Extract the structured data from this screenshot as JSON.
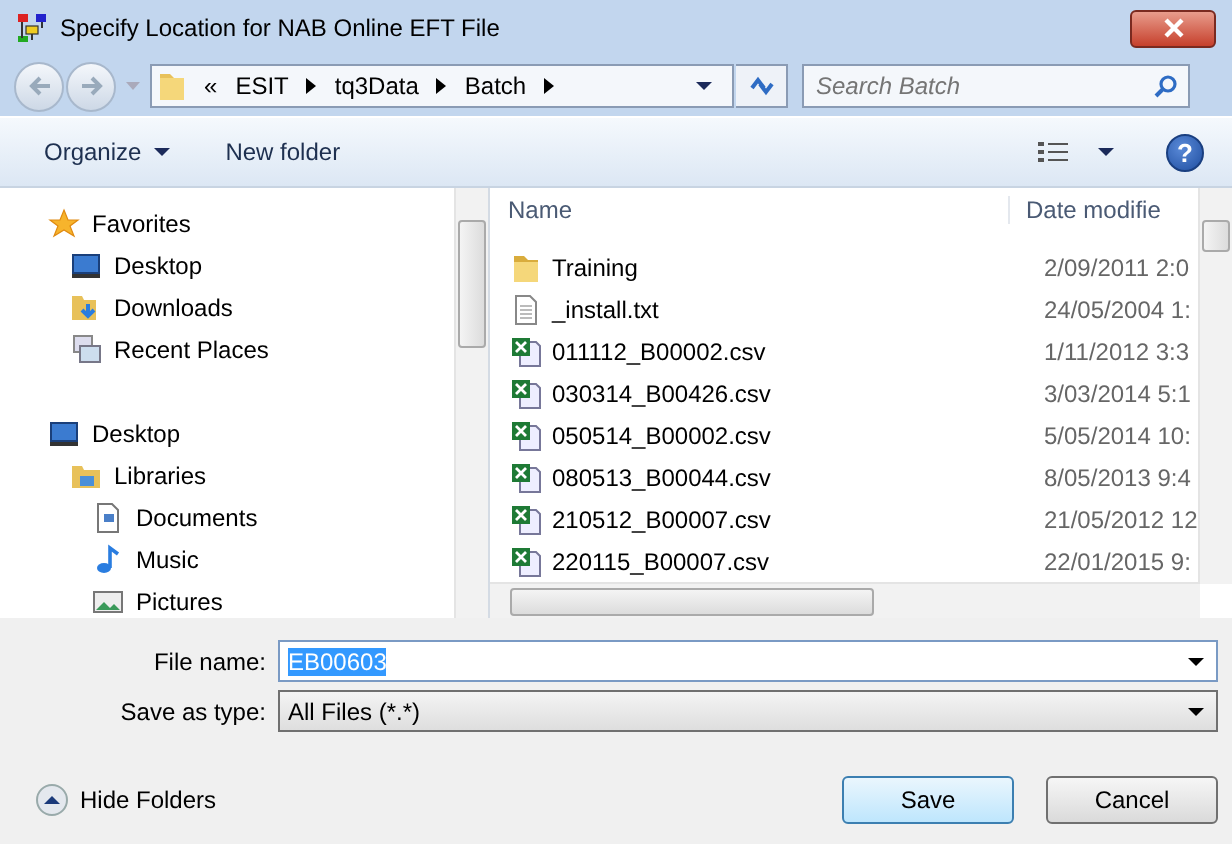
{
  "window": {
    "title": "Specify Location for NAB Online EFT File"
  },
  "breadcrumb": {
    "overflow": "«",
    "segments": [
      "ESIT",
      "tq3Data",
      "Batch"
    ]
  },
  "search": {
    "placeholder": "Search Batch"
  },
  "toolbar": {
    "organize": "Organize",
    "new_folder": "New folder",
    "help": "?"
  },
  "navigation": [
    {
      "label": "Favorites",
      "kind": "favorites",
      "children": [
        {
          "label": "Desktop",
          "kind": "desktop"
        },
        {
          "label": "Downloads",
          "kind": "downloads"
        },
        {
          "label": "Recent Places",
          "kind": "recent"
        }
      ]
    },
    {
      "label": "Desktop",
      "kind": "desktop",
      "children": [
        {
          "label": "Libraries",
          "kind": "libraries",
          "children": [
            {
              "label": "Documents",
              "kind": "documents"
            },
            {
              "label": "Music",
              "kind": "music"
            },
            {
              "label": "Pictures",
              "kind": "pictures"
            }
          ]
        }
      ]
    }
  ],
  "table": {
    "columns": [
      "Name",
      "Date modifie"
    ],
    "rows": [
      {
        "name": "Training",
        "date": "2/09/2011 2:0",
        "kind": "folder"
      },
      {
        "name": "_install.txt",
        "date": "24/05/2004 1:",
        "kind": "text"
      },
      {
        "name": "011112_B00002.csv",
        "date": "1/11/2012 3:3",
        "kind": "spreadsheet"
      },
      {
        "name": "030314_B00426.csv",
        "date": "3/03/2014 5:1",
        "kind": "spreadsheet"
      },
      {
        "name": "050514_B00002.csv",
        "date": "5/05/2014 10:",
        "kind": "spreadsheet"
      },
      {
        "name": "080513_B00044.csv",
        "date": "8/05/2013 9:4",
        "kind": "spreadsheet"
      },
      {
        "name": "210512_B00007.csv",
        "date": "21/05/2012 12",
        "kind": "spreadsheet"
      },
      {
        "name": "220115_B00007.csv",
        "date": "22/01/2015 9:",
        "kind": "spreadsheet"
      }
    ]
  },
  "file_name": {
    "label": "File name:",
    "value": "EB00603"
  },
  "save_as_type": {
    "label": "Save as type:",
    "value": "All Files (*.*)"
  },
  "hide_folders": "Hide Folders",
  "buttons": [
    "Save",
    "Cancel"
  ]
}
